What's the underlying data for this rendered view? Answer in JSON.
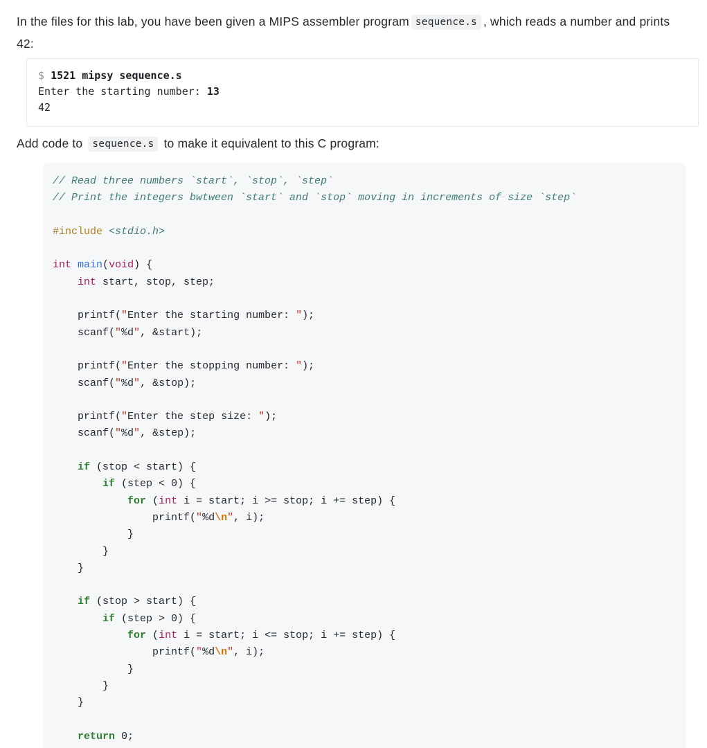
{
  "intro": {
    "before_code": "In the files for this lab, you have been given a MIPS assembler program",
    "code": "sequence.s",
    "after_code": ", which reads a number and prints 42:"
  },
  "terminal": {
    "prompt": "$",
    "command": "1521 mipsy sequence.s",
    "line2_label": "Enter the starting number: ",
    "line2_input": "13",
    "line3_output": "42"
  },
  "instruction": {
    "before_code": "Add code to",
    "code": "sequence.s",
    "after_code": "to make it equivalent to this C program:"
  },
  "code": {
    "language": "c",
    "lines": [
      "// Read three numbers `start`, `stop`, `step`",
      "// Print the integers bwtween `start` and `stop` moving in increments of size `step`",
      "",
      "#include <stdio.h>",
      "",
      "int main(void) {",
      "    int start, stop, step;",
      "",
      "    printf(\"Enter the starting number: \");",
      "    scanf(\"%d\", &start);",
      "",
      "    printf(\"Enter the stopping number: \");",
      "    scanf(\"%d\", &stop);",
      "",
      "    printf(\"Enter the step size: \");",
      "    scanf(\"%d\", &step);",
      "",
      "    if (stop < start) {",
      "        if (step < 0) {",
      "            for (int i = start; i >= stop; i += step) {",
      "                printf(\"%d\\n\", i);",
      "            }",
      "        }",
      "    }",
      "",
      "    if (stop > start) {",
      "        if (step > 0) {",
      "            for (int i = start; i <= stop; i += step) {",
      "                printf(\"%d\\n\", i);",
      "            }",
      "        }",
      "    }",
      "",
      "    return 0;",
      "}"
    ]
  },
  "colors": {
    "comment": "#3e7d78",
    "preprocessor": "#b07d1c",
    "type_keyword": "#a71d5d",
    "function_name": "#3a6ee8",
    "control_keyword": "#2f8132",
    "string": "#c0392b",
    "escape": "#d47500",
    "text": "#24292e",
    "code_background": "#f6f7f8",
    "inline_code_background": "#f0f1f2",
    "terminal_border": "#e6e8ea",
    "prompt": "#8b949e"
  }
}
